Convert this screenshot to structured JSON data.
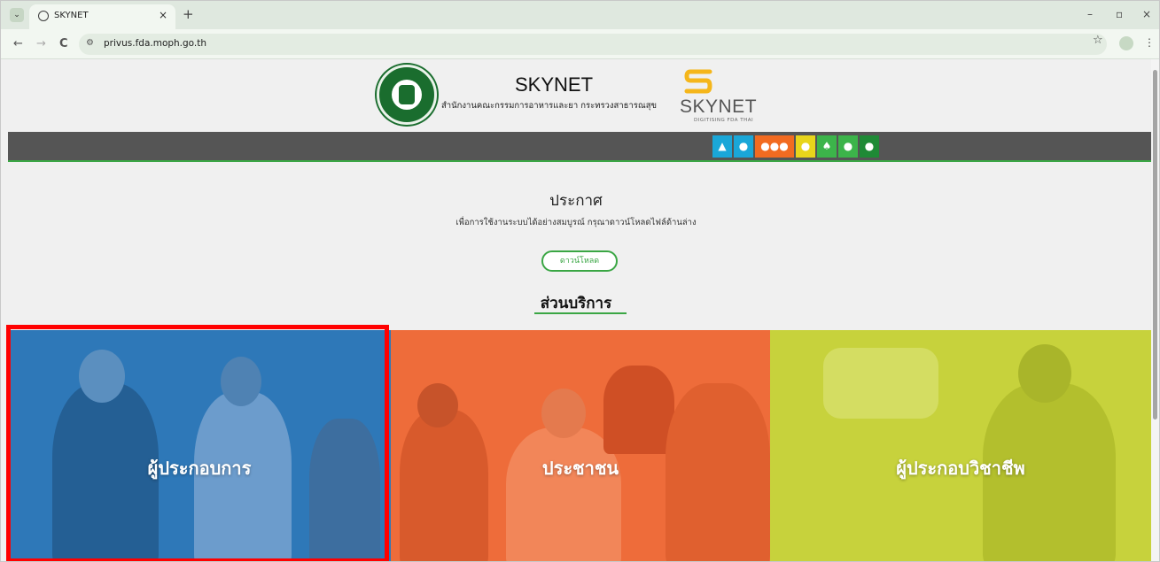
{
  "browser": {
    "tab_title": "SKYNET",
    "tab_close": "×",
    "new_tab": "+",
    "url": "privus.fda.moph.go.th",
    "nav_back": "←",
    "nav_forward": "→",
    "nav_reload": "C",
    "window_minimize": "–",
    "window_restore": "▫",
    "window_close": "×"
  },
  "header": {
    "title": "SKYNET",
    "subtitle": "สำนักงานคณะกรรมการอาหารและยา กระทรวงสาธารณสุข",
    "logo_text": "SKYNET",
    "logo_tagline": "DIGITISING FDA THAI"
  },
  "nav_icons": [
    {
      "name": "home-icon",
      "color": "#1aa7d8",
      "glyph": "🏠"
    },
    {
      "name": "person-icon",
      "color": "#1aa7d8",
      "glyph": "👤"
    },
    {
      "name": "group-icon",
      "color": "#f26b21",
      "glyph": "👥"
    },
    {
      "name": "user-yellow-icon",
      "color": "#e8d51b",
      "glyph": "👤"
    },
    {
      "name": "tree-icon",
      "color": "#3cb44a",
      "glyph": "✦"
    },
    {
      "name": "user-green-icon",
      "color": "#3cb44a",
      "glyph": "👤"
    },
    {
      "name": "user-darkgreen-icon",
      "color": "#1f8a36",
      "glyph": "👤"
    }
  ],
  "announcement": {
    "title": "ประกาศ",
    "text": "เพื่อการใช้งานระบบได้อย่างสมบูรณ์ กรุณาดาวน์โหลดไฟล์ด้านล่าง",
    "download_label": "ดาวน์โหลด"
  },
  "services": {
    "title": "ส่วนบริการ",
    "tiles": [
      {
        "label": "ผู้ประกอบการ",
        "color": "#2e78b8"
      },
      {
        "label": "ประชาชน",
        "color": "#ee6c3a"
      },
      {
        "label": "ผู้ประกอบวิชาชีพ",
        "color": "#c7d23c"
      }
    ]
  }
}
